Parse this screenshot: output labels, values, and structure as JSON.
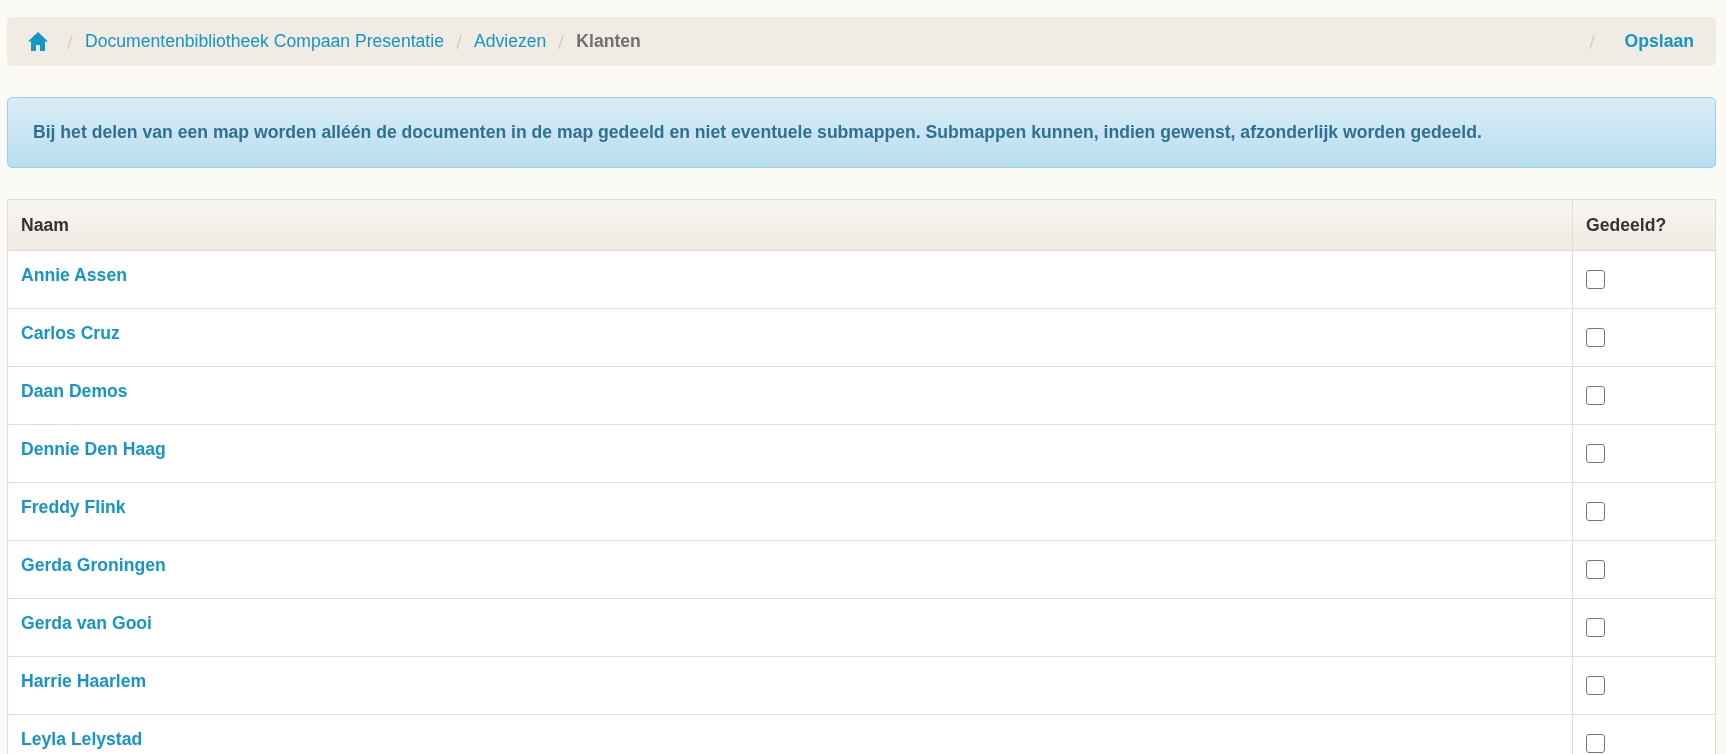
{
  "breadcrumb": {
    "items": [
      {
        "kind": "home"
      },
      {
        "kind": "link",
        "label": "Documentenbibliotheek Compaan Presentatie"
      },
      {
        "kind": "link",
        "label": "Adviezen"
      },
      {
        "kind": "current",
        "label": "Klanten"
      }
    ],
    "actions": [
      {
        "label": "Opslaan"
      }
    ]
  },
  "alert": {
    "text": "Bij het delen van een map worden alléén de documenten in de map gedeeld en niet eventuele submappen. Submappen kunnen, indien gewenst, afzonderlijk worden gedeeld."
  },
  "table": {
    "columns": [
      "Naam",
      "Gedeeld?"
    ],
    "rows": [
      {
        "name": "Annie Assen",
        "checked": false
      },
      {
        "name": "Carlos Cruz",
        "checked": false
      },
      {
        "name": "Daan Demos",
        "checked": false
      },
      {
        "name": "Dennie Den Haag",
        "checked": false
      },
      {
        "name": "Freddy Flink",
        "checked": false
      },
      {
        "name": "Gerda Groningen",
        "checked": false
      },
      {
        "name": "Gerda van Gooi",
        "checked": false
      },
      {
        "name": "Harrie Haarlem",
        "checked": false
      },
      {
        "name": "Leyla Lelystad",
        "checked": false
      }
    ]
  }
}
